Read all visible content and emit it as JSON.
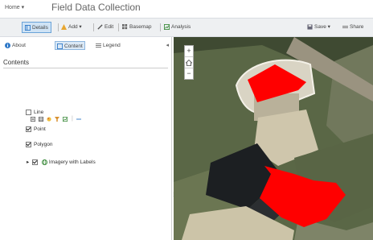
{
  "header": {
    "home_label": "Home ▾",
    "title": "Field Data Collection"
  },
  "toolbar": {
    "details": "Details",
    "add": "Add ▾",
    "edit": "Edit",
    "basemap": "Basemap",
    "analysis": "Analysis",
    "save": "Save ▾",
    "share": "Share"
  },
  "panel": {
    "tabs": {
      "about": "About",
      "content": "Content",
      "legend": "Legend"
    },
    "contents_heading": "Contents",
    "layers": [
      {
        "name": "Line",
        "checked": false
      },
      {
        "name": "Point",
        "checked": true
      },
      {
        "name": "Polygon",
        "checked": true
      },
      {
        "name": "Imagery with Labels",
        "checked": true
      }
    ]
  },
  "map": {
    "zoom_in": "+",
    "home": "⌂",
    "zoom_out": "−",
    "polygon_color": "#ff0000"
  },
  "colors": {
    "accent": "#2e78c7",
    "toolbar_bg": "#eef0f2",
    "active_tab": "#cfe3f5"
  }
}
